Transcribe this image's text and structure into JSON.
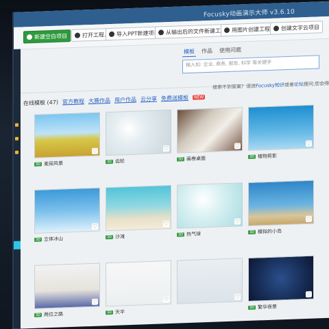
{
  "window": {
    "title": "Focusky动画演示大师 v3.6.10"
  },
  "toolbar": {
    "buttons": [
      {
        "label": "新建空白项目",
        "icon": "plus-icon"
      },
      {
        "label": "打开工程...",
        "icon": "folder-icon"
      },
      {
        "label": "导入PPT新建项目",
        "icon": "ppt-icon"
      },
      {
        "label": "从输出后的文件新建工程",
        "icon": "import-icon"
      },
      {
        "label": "用图片创建工程",
        "icon": "image-icon"
      },
      {
        "label": "创建文字云项目",
        "icon": "cloud-icon"
      }
    ]
  },
  "search": {
    "tabs": [
      "模板",
      "作品",
      "使用问题"
    ],
    "placeholder": "输入如: 企业, 商务, 报告, 科学 等关键字"
  },
  "hint": {
    "prefix": "搜索不到答案？请进",
    "link1": "Focusky知识",
    "mid": "或者",
    "link2": "论坛",
    "suffix": "提问,您会得到"
  },
  "filter": {
    "label": "在线模板 (47)",
    "links": [
      "官方教程",
      "大赛作品",
      "用户作品",
      "云分享",
      "免费送模板"
    ],
    "new_badge": "NEW"
  },
  "templates": [
    {
      "title": "麦田风景",
      "badge": "3D"
    },
    {
      "title": "齿轮",
      "badge": "3D"
    },
    {
      "title": "画卷桌面",
      "badge": "3D"
    },
    {
      "title": "植物剪影",
      "badge": "3D"
    },
    {
      "title": "立体冰山",
      "badge": "3D"
    },
    {
      "title": "沙滩",
      "badge": "3D"
    },
    {
      "title": "热气球",
      "badge": "3D"
    },
    {
      "title": "模拟的小岛",
      "badge": "3D"
    },
    {
      "title": "两位之路",
      "badge": "3D"
    },
    {
      "title": "天平",
      "badge": "3D"
    },
    {
      "title": "",
      "badge": ""
    },
    {
      "title": "繁华夜景",
      "badge": "3D"
    }
  ],
  "colors": {
    "accent": "#2a63c7",
    "primary_button": "#2d9a3e",
    "titlebar": "#2f5f8f"
  }
}
